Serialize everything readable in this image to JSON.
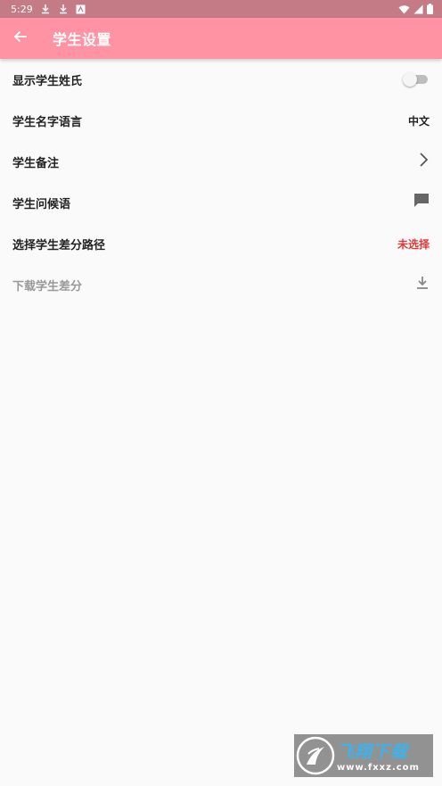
{
  "status_bar": {
    "time": "5:29"
  },
  "app_bar": {
    "title": "学生设置",
    "back_icon": "arrow-left-icon",
    "color": "#ff93a4"
  },
  "settings": [
    {
      "label": "显示学生姓氏",
      "control": "switch",
      "checked": false
    },
    {
      "label": "学生名字语言",
      "value": "中文"
    },
    {
      "label": "学生备注",
      "icon": "chevron-right-icon"
    },
    {
      "label": "学生问候语",
      "icon": "message-icon"
    },
    {
      "label": "选择学生差分路径",
      "value": "未选择",
      "value_color": "#e53935"
    },
    {
      "label": "下载学生差分",
      "icon": "download-icon",
      "disabled": true
    }
  ],
  "watermark": {
    "title": "飞翔下载",
    "url": "www.fxxz.com"
  }
}
